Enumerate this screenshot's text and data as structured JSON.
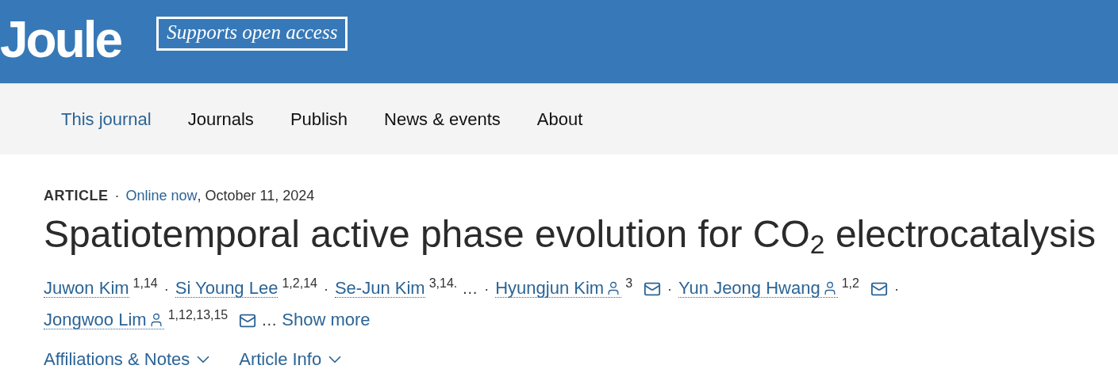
{
  "header": {
    "logo": "Joule",
    "badge": "Supports open access"
  },
  "nav": [
    {
      "label": "This journal",
      "selected": true
    },
    {
      "label": "Journals",
      "selected": false
    },
    {
      "label": "Publish",
      "selected": false
    },
    {
      "label": "News & events",
      "selected": false
    },
    {
      "label": "About",
      "selected": false
    }
  ],
  "article": {
    "type": "ARTICLE",
    "separator": "·",
    "status": "Online now",
    "date": ", October 11, 2024",
    "title": "Spatiotemporal active phase evolution for CO$_{2}$ electrocatalysis",
    "author_lines": [
      [
        {
          "kind": "author",
          "name": "Juwon Kim",
          "affiliations": "1,14",
          "corresponding": false,
          "after": "·"
        },
        {
          "kind": "author",
          "name": "Si Young Lee",
          "affiliations": "1,2,14",
          "corresponding": false,
          "after": "·"
        },
        {
          "kind": "author",
          "name": "Se-Jun Kim",
          "affiliations": "3,14.",
          "corresponding": false
        },
        {
          "kind": "ellipsis",
          "text": "…",
          "after": "·"
        },
        {
          "kind": "author",
          "name": "Hyungjun Kim",
          "affiliations": "3",
          "corresponding": true,
          "after": "·"
        },
        {
          "kind": "author",
          "name": "Yun Jeong Hwang",
          "affiliations": "1,2",
          "corresponding": true,
          "after": "·"
        }
      ],
      [
        {
          "kind": "author",
          "name": "Jongwoo Lim",
          "affiliations": "1,12,13,15",
          "corresponding": true
        },
        {
          "kind": "ellipsis",
          "text": "…"
        },
        {
          "kind": "more",
          "text": "Show more"
        }
      ]
    ],
    "toggles": [
      {
        "label": "Affiliations & Notes",
        "expanded": false
      },
      {
        "label": "Article Info",
        "expanded": false
      }
    ]
  }
}
